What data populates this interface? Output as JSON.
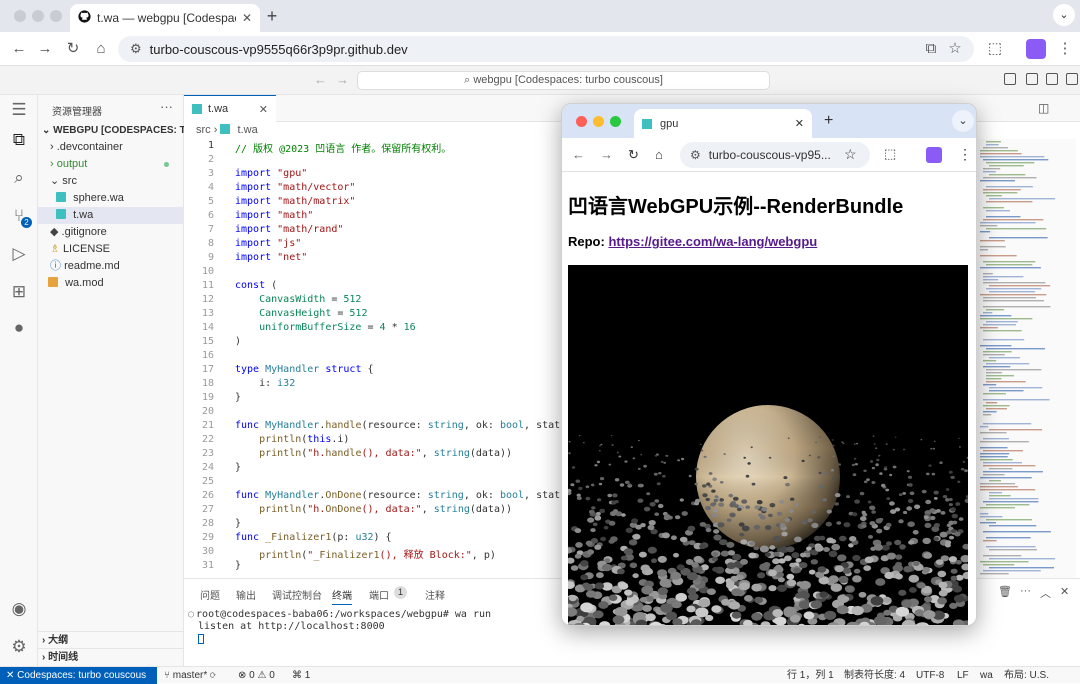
{
  "browser": {
    "tab_title": "t.wa — webgpu [Codespaces: turbo couscous]",
    "url": "turbo-couscous-vp9555q66r3p9pr.github.dev"
  },
  "vscode": {
    "command_center": "webgpu [Codespaces: turbo couscous]",
    "explorer_label": "资源管理器",
    "workspace_root": "WEBGPU [CODESPACES: T...",
    "tree": [
      {
        "label": ".devcontainer",
        "kind": "folder-closed"
      },
      {
        "label": "output",
        "kind": "folder-closed"
      },
      {
        "label": "src",
        "kind": "folder-open"
      },
      {
        "label": "sphere.wa",
        "kind": "wa"
      },
      {
        "label": "t.wa",
        "kind": "wa"
      },
      {
        "label": ".gitignore",
        "kind": "git"
      },
      {
        "label": "LICENSE",
        "kind": "license"
      },
      {
        "label": "readme.md",
        "kind": "info"
      },
      {
        "label": "wa.mod",
        "kind": "mod"
      }
    ],
    "outline_label": "大纲",
    "timeline_label": "时间线",
    "editor_tab": "t.wa",
    "breadcrumb_folder": "src",
    "breadcrumb_file": "t.wa",
    "code_lines": [
      "// 版权 @2023 凹语言 作者。保留所有权利。",
      "",
      "import \"gpu\"",
      "import \"math/vector\"",
      "import \"math/matrix\"",
      "import \"math\"",
      "import \"math/rand\"",
      "import \"js\"",
      "import \"net\"",
      "",
      "const (",
      "    CanvasWidth = 512",
      "    CanvasHeight = 512",
      "    uniformBufferSize = 4 * 16",
      ")",
      "",
      "type MyHandler struct {",
      "    i: i32",
      "}",
      "",
      "func MyHandler.handle(resource: string, ok: bool, status:",
      "    println(this.i)",
      "    println(\"h.handle(), data:\", string(data))",
      "}",
      "",
      "func MyHandler.OnDone(resource: string, ok: bool, status:",
      "    println(\"h.OnDone(), data:\", string(data))",
      "}",
      "func _Finalizer1(p: u32) {",
      "    println(\"_Finalizer1(), 释放 Block:\", p)",
      "}"
    ],
    "panel_tabs": [
      "问题",
      "输出",
      "调试控制台",
      "终端",
      "端口",
      "注释"
    ],
    "ports_count": "1",
    "terminal_lines": [
      "root@codespaces-baba06:/workspaces/webgpu# wa run",
      "listen at http://localhost:8000"
    ],
    "status": {
      "remote": "Codespaces: turbo couscous",
      "branch": "master*",
      "errors": "0",
      "warnings": "0",
      "ports": "1",
      "position": "行 1，列 1",
      "tab_size": "制表符长度: 4",
      "encoding": "UTF-8",
      "eol": "LF",
      "language": "wa",
      "layout": "布局: U.S."
    }
  },
  "popup": {
    "tab_title": "gpu",
    "url": "turbo-couscous-vp95...",
    "heading": "凹语言WebGPU示例--RenderBundle",
    "repo_label": "Repo:",
    "repo_link": "https://gitee.com/wa-lang/webgpu"
  }
}
